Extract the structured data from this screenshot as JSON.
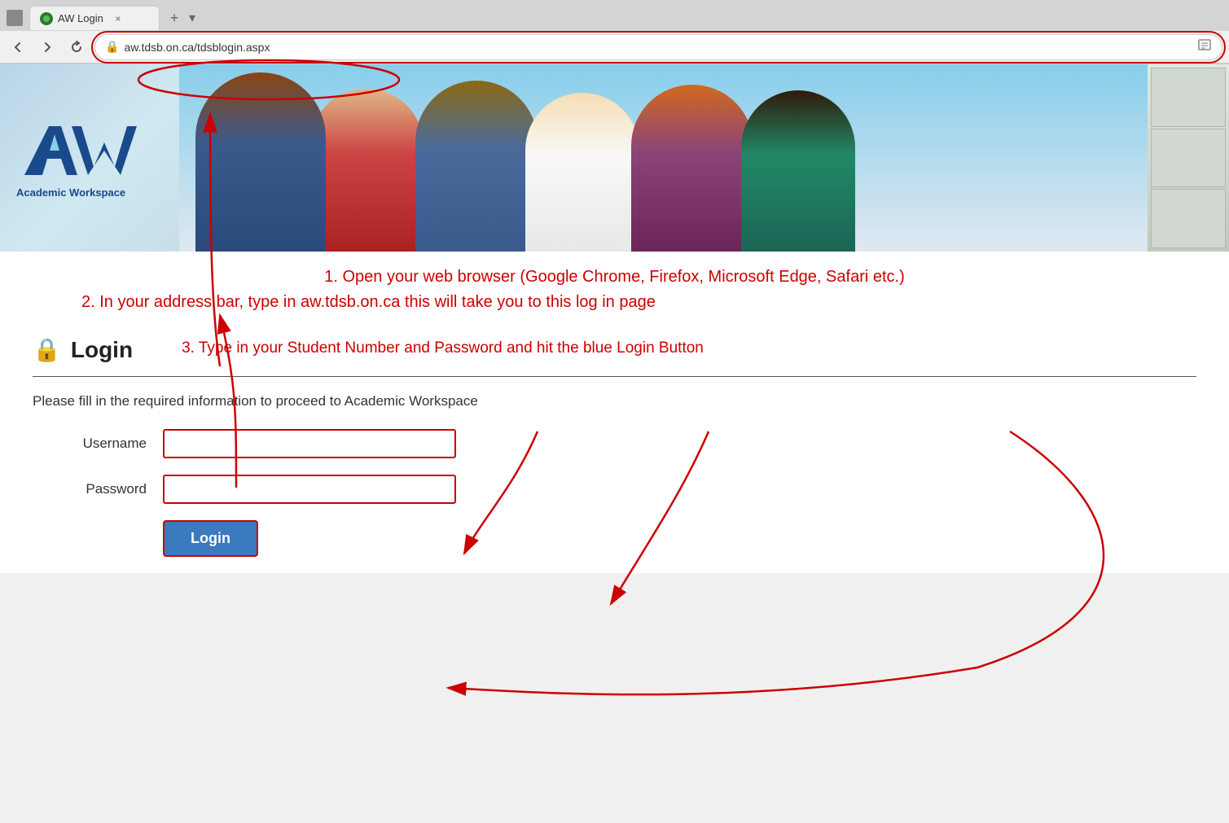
{
  "browser": {
    "tab_title": "AW Login",
    "tab_close": "×",
    "tab_new": "+",
    "tab_list": "▾",
    "nav_back": "→",
    "nav_reload": "↺",
    "address_url": "aw.tdsb.on.ca/tdsblogin.aspx",
    "address_domain": "aw.",
    "address_path": "tdsb.on.ca/tdsblogin.aspx",
    "reader_icon": "📖"
  },
  "hero": {
    "logo_text": "AW",
    "logo_sub": "Academic Workspace"
  },
  "instructions": {
    "step1": "1. Open your web browser (Google Chrome, Firefox, Microsoft Edge, Safari etc.)",
    "step2": "2. In your address bar, type in   aw.tdsb.on.ca   this will take you to this log in page",
    "step3": "3. Type in your Student Number and Password and hit the blue Login Button"
  },
  "login_form": {
    "icon": "🔒",
    "title": "Login",
    "description": "Please fill in the required information to proceed to Academic Workspace",
    "username_label": "Username",
    "username_placeholder": "",
    "password_label": "Password",
    "password_placeholder": "",
    "login_btn": "Login"
  },
  "colors": {
    "red_annotation": "#cc0000",
    "blue_btn": "#3a7abf",
    "logo_blue": "#1a4a8c"
  }
}
